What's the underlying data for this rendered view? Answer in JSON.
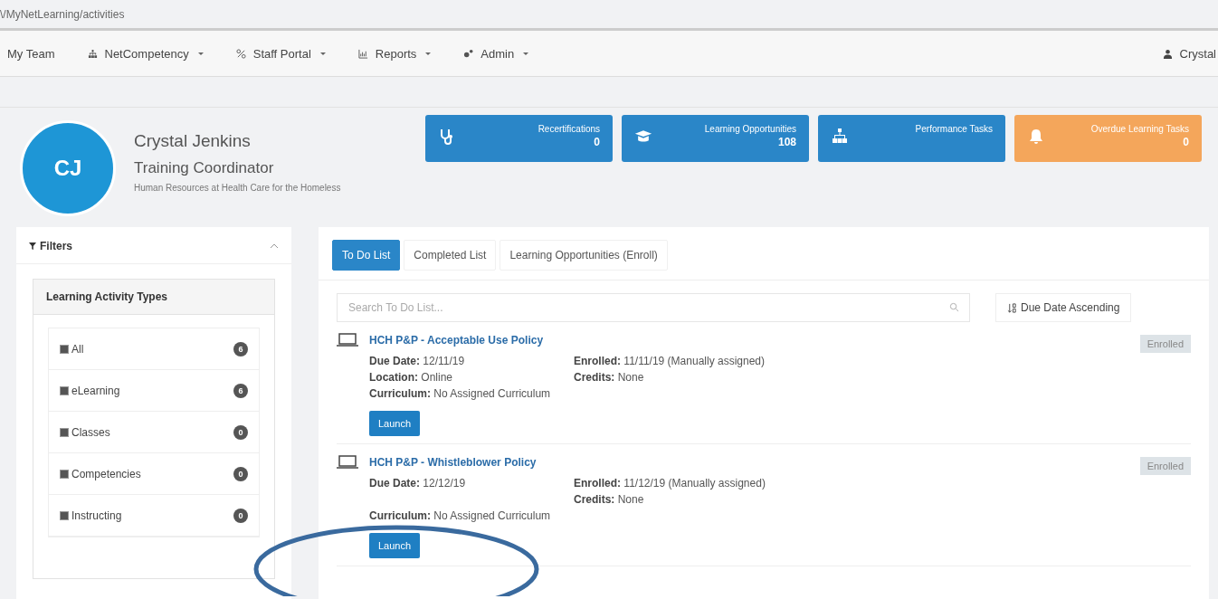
{
  "address_bar": {
    "url": "\\/MyNetLearning/activities"
  },
  "nav": {
    "items": [
      {
        "label": "My Team",
        "dropdown": false
      },
      {
        "label": "NetCompetency",
        "dropdown": true
      },
      {
        "label": "Staff Portal",
        "dropdown": true
      },
      {
        "label": "Reports",
        "dropdown": true
      },
      {
        "label": "Admin",
        "dropdown": true
      }
    ],
    "user": "Crystal"
  },
  "profile": {
    "initials": "CJ",
    "name": "Crystal Jenkins",
    "role": "Training Coordinator",
    "department": "Human Resources at Health Care for the Homeless"
  },
  "stat_cards": [
    {
      "label": "Recertifications",
      "count": "0",
      "color": "#2a86c8"
    },
    {
      "label": "Learning Opportunities",
      "count": "108",
      "color": "#2a86c8"
    },
    {
      "label": "Performance Tasks",
      "color": "#2a86c8"
    },
    {
      "label": "Overdue Learning Tasks",
      "count": "0",
      "color": "#f4a65b"
    }
  ],
  "filters": {
    "title": "Filters",
    "group_title": "Learning Activity Types",
    "items": [
      {
        "label": "All",
        "checked": true,
        "count": "6"
      },
      {
        "label": "eLearning",
        "checked": true,
        "count": "6"
      },
      {
        "label": "Classes",
        "checked": true,
        "count": "0"
      },
      {
        "label": "Competencies",
        "checked": true,
        "count": "0"
      },
      {
        "label": "Instructing",
        "checked": true,
        "count": "0"
      }
    ]
  },
  "tabs": [
    {
      "label": "To Do List",
      "selected": true
    },
    {
      "label": "Completed List",
      "selected": false
    },
    {
      "label": "Learning Opportunities (Enroll)",
      "selected": false
    }
  ],
  "search": {
    "placeholder": "Search To Do List..."
  },
  "sort": {
    "label": "Due Date Ascending"
  },
  "activities": [
    {
      "title": "HCH P&P - Acceptable Use Policy",
      "status": "Enrolled",
      "due": {
        "label": "Due Date:",
        "value": "12/11/19"
      },
      "location": {
        "label": "Location:",
        "value": "Online"
      },
      "curriculum": {
        "label": "Curriculum:",
        "value": "No Assigned Curriculum"
      },
      "enrolled": {
        "label": "Enrolled:",
        "value": "11/11/19 (Manually assigned)"
      },
      "credits": {
        "label": "Credits:",
        "value": "None"
      },
      "button": "Launch"
    },
    {
      "title": "HCH P&P - Whistleblower Policy",
      "status": "Enrolled",
      "due": {
        "label": "Due Date:",
        "value": "12/12/19"
      },
      "curriculum": {
        "label": "Curriculum:",
        "value": "No Assigned Curriculum"
      },
      "enrolled": {
        "label": "Enrolled:",
        "value": "11/12/19 (Manually assigned)"
      },
      "credits": {
        "label": "Credits:",
        "value": "None"
      },
      "button": "Launch",
      "circled": true
    }
  ]
}
